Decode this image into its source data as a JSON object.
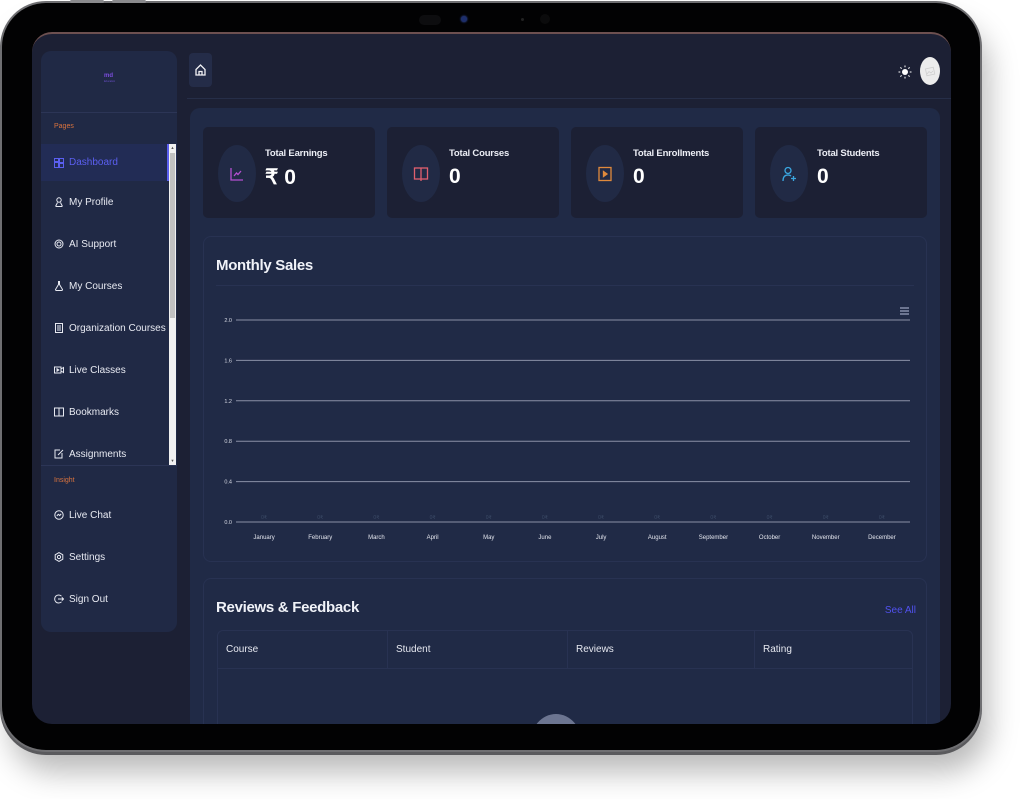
{
  "app": {
    "logo_text": "md",
    "logo_subtext": "Education"
  },
  "sidebar": {
    "pages_label": "Pages",
    "insight_label": "Insight",
    "items": [
      {
        "label": "Dashboard",
        "icon": "dashboard-grid-icon",
        "active": true
      },
      {
        "label": "My Profile",
        "icon": "user-icon"
      },
      {
        "label": "AI Support",
        "icon": "headset-icon"
      },
      {
        "label": "My Courses",
        "icon": "course-flask-icon"
      },
      {
        "label": "Organization Courses",
        "icon": "document-list-icon"
      },
      {
        "label": "Live Classes",
        "icon": "video-camera-icon"
      },
      {
        "label": "Bookmarks",
        "icon": "book-open-icon"
      },
      {
        "label": "Assignments",
        "icon": "edit-square-icon"
      }
    ],
    "insight_items": [
      {
        "label": "Live Chat",
        "icon": "messenger-chat-icon"
      },
      {
        "label": "Settings",
        "icon": "settings-gear-icon"
      },
      {
        "label": "Sign Out",
        "icon": "sign-out-icon"
      }
    ]
  },
  "topbar": {
    "home_icon": "home-icon",
    "theme_icon": "sun-icon",
    "avatar_icon": "image-placeholder-icon"
  },
  "stats": [
    {
      "title": "Total Earnings",
      "value": "₹ 0",
      "icon": "line-chart-icon",
      "color": "#b44fd0"
    },
    {
      "title": "Total Courses",
      "value": "0",
      "icon": "book-icon",
      "color": "#e0606e"
    },
    {
      "title": "Total Enrollments",
      "value": "0",
      "icon": "play-square-icon",
      "color": "#e08a3c"
    },
    {
      "title": "Total Students",
      "value": "0",
      "icon": "user-plus-icon",
      "color": "#3aa6e0"
    }
  ],
  "sales": {
    "title": "Monthly Sales",
    "menu_icon": "hamburger-menu-icon"
  },
  "chart_data": {
    "type": "bar",
    "title": "Monthly Sales",
    "categories": [
      "January",
      "February",
      "March",
      "April",
      "May",
      "June",
      "July",
      "August",
      "September",
      "October",
      "November",
      "December"
    ],
    "values": [
      0,
      0,
      0,
      0,
      0,
      0,
      0,
      0,
      0,
      0,
      0,
      0
    ],
    "data_labels": [
      "0₹",
      "0₹",
      "0₹",
      "0₹",
      "0₹",
      "0₹",
      "0₹",
      "0₹",
      "0₹",
      "0₹",
      "0₹",
      "0₹"
    ],
    "y_ticks": [
      "0.0",
      "0.4",
      "0.8",
      "1.2",
      "1.6",
      "2.0"
    ],
    "ylim": [
      0,
      2.0
    ],
    "xlabel": "",
    "ylabel": "",
    "grid": true
  },
  "reviews": {
    "title": "Reviews & Feedback",
    "see_all": "See All",
    "columns": [
      "Course",
      "Student",
      "Reviews",
      "Rating"
    ],
    "rows": []
  },
  "colors": {
    "accent": "#5b5ff0",
    "section_label": "#d9733e",
    "link": "#5151ee"
  }
}
